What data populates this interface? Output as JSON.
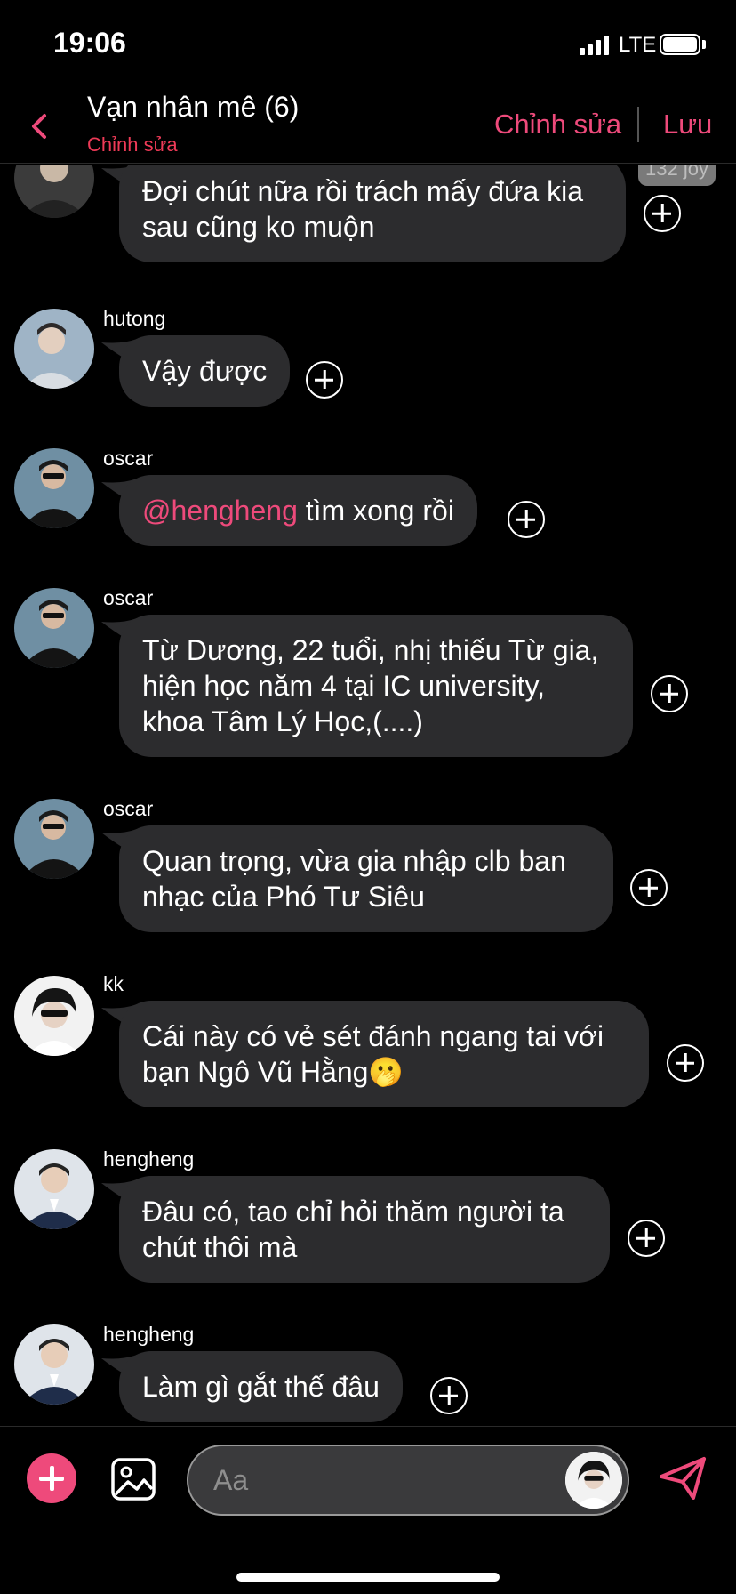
{
  "status": {
    "time": "19:06",
    "network": "LTE",
    "signal_bars": 4,
    "battery_level": 1.0
  },
  "header": {
    "title": "Vạn nhân mê (6)",
    "subtitle": "Chỉnh sửa",
    "edit_label": "Chỉnh sửa",
    "save_label": "Lưu"
  },
  "messages": [
    {
      "sender": "",
      "avatar": "dark-sweater-avatar",
      "text": "Đợi chút nữa rồi trách mấy đứa kia sau cũng ko muộn",
      "badge": "132 joy"
    },
    {
      "sender": "hutong",
      "avatar": "hutong-avatar",
      "text": "Vậy được"
    },
    {
      "sender": "oscar",
      "avatar": "oscar-avatar",
      "mention": "@hengheng",
      "text": " tìm xong rồi"
    },
    {
      "sender": "oscar",
      "avatar": "oscar-avatar",
      "text": "Từ Dương, 22 tuổi, nhị thiếu Từ gia, hiện học năm 4 tại IC university, khoa Tâm Lý Học,(....)"
    },
    {
      "sender": "oscar",
      "avatar": "oscar-avatar",
      "text": "Quan trọng, vừa gia nhập clb ban nhạc của Phó Tư Siêu"
    },
    {
      "sender": "kk",
      "avatar": "kk-avatar",
      "text": "Cái này có vẻ sét đánh ngang tai với bạn Ngô Vũ Hằng🫢"
    },
    {
      "sender": "hengheng",
      "avatar": "hengheng-avatar",
      "text": "Đâu có, tao chỉ hỏi thăm người ta chút thôi mà"
    },
    {
      "sender": "hengheng",
      "avatar": "hengheng-avatar",
      "text": "Làm gì gắt thế đâu"
    }
  ],
  "composer": {
    "placeholder": "Aa"
  },
  "colors": {
    "accent": "#ee4a7b",
    "subtitle_red": "#ee3a57",
    "bubble": "#2c2c2e",
    "background": "#000000"
  }
}
